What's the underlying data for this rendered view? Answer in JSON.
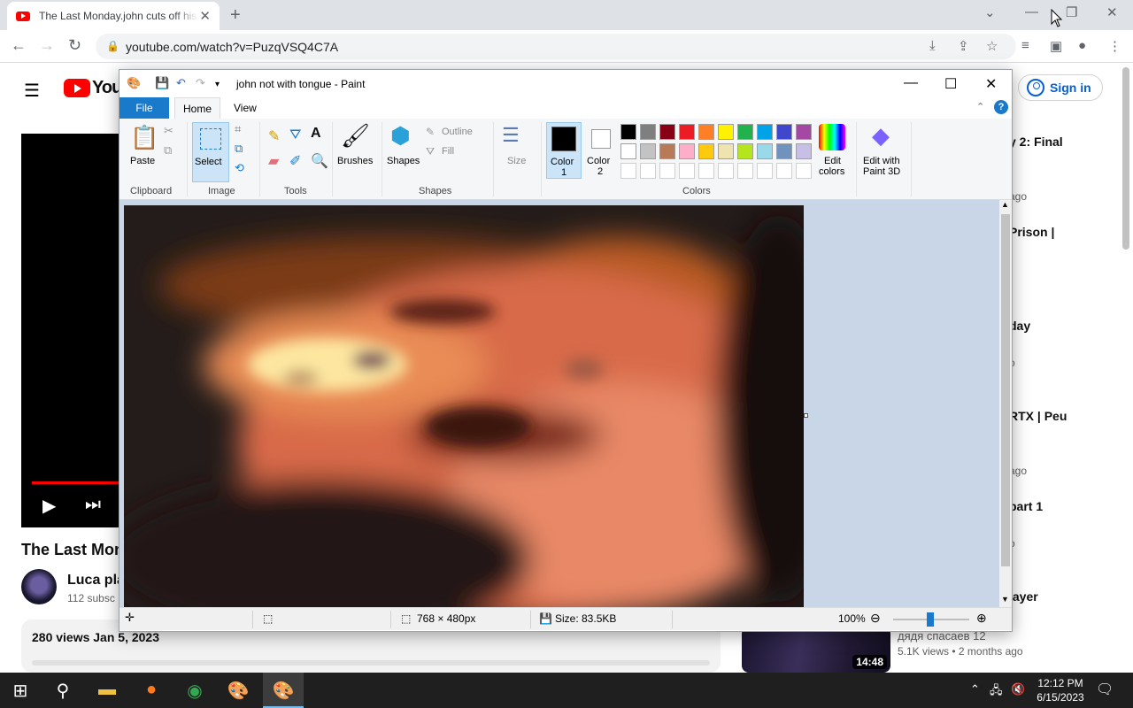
{
  "browser": {
    "tab_title": "The Last Monday.john cuts off his",
    "url": "youtube.com/watch?v=PuzqVSQ4C7A"
  },
  "youtube": {
    "logo_text": "YouT",
    "signin_label": "Sign in",
    "video_title": "The Last Mon",
    "channel_name": "Luca pla",
    "channel_subs": "112 subsc",
    "views_date": "280 views  Jan 5, 2023",
    "recommendations": [
      {
        "title": "y 2: Final",
        "meta": "ago"
      },
      {
        "title": "Prison |",
        "meta": ""
      },
      {
        "title": "day",
        "meta": "o"
      },
      {
        "title": "RTX | Peu",
        "meta": "ago"
      },
      {
        "title": "part 1",
        "meta": "o"
      },
      {
        "title": "layer",
        "meta": ""
      }
    ],
    "bottom_rec": {
      "duration": "14:48",
      "title": "дядя спасаев 12",
      "meta": "5.1K views  • 2 months ago"
    }
  },
  "paint": {
    "title": "john not with tongue - Paint",
    "tabs": {
      "file": "File",
      "home": "Home",
      "view": "View"
    },
    "ribbon": {
      "paste": "Paste",
      "select": "Select",
      "brushes": "Brushes",
      "shapes": "Shapes",
      "outline": "Outline",
      "fill": "Fill",
      "size": "Size",
      "color1_a": "Color",
      "color1_b": "1",
      "color2_a": "Color",
      "color2_b": "2",
      "edit_colors_a": "Edit",
      "edit_colors_b": "colors",
      "paint3d_a": "Edit with",
      "paint3d_b": "Paint 3D"
    },
    "groups": {
      "clipboard": "Clipboard",
      "image": "Image",
      "tools": "Tools",
      "shapes": "Shapes",
      "colors": "Colors"
    },
    "palette_row1": [
      "#000000",
      "#7f7f7f",
      "#880015",
      "#ed1c24",
      "#ff7f27",
      "#fff200",
      "#22b14c",
      "#00a2e8",
      "#3f48cc",
      "#a349a4"
    ],
    "palette_row2": [
      "#ffffff",
      "#c3c3c3",
      "#b97a57",
      "#ffaec9",
      "#ffc90e",
      "#efe4b0",
      "#b5e61d",
      "#99d9ea",
      "#7092be",
      "#c8bfe7"
    ],
    "status": {
      "dimensions": "768 × 480px",
      "size": "Size: 83.5KB",
      "zoom": "100%"
    }
  },
  "taskbar": {
    "time": "12:12 PM",
    "date": "6/15/2023"
  }
}
